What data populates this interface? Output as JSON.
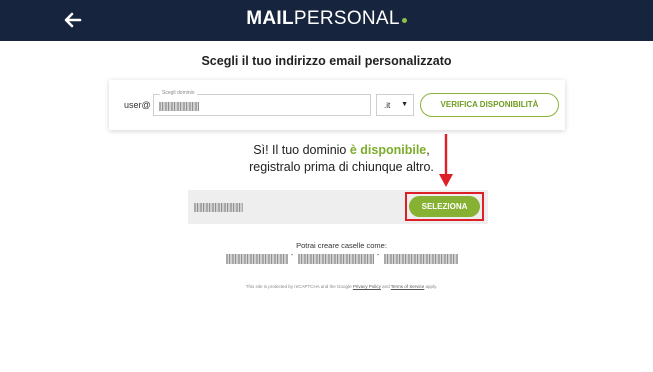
{
  "header": {
    "logo_bold": "MAIL",
    "logo_light": "PERSONAL",
    "colors": {
      "background": "#16253d",
      "accent": "#8bc34a"
    }
  },
  "main": {
    "title": "Scegli il tuo indirizzo email personalizzato",
    "search": {
      "prefix": "user@",
      "field_label": "Scegli dominio",
      "tld_selected": ".it",
      "verify_label": "VERIFICA DISPONIBILITÀ"
    },
    "result": {
      "line1_pre": "Sì! Il tuo dominio ",
      "line1_highlight": "è disponibile",
      "line1_post": ",",
      "line2": "registralo prima di chiunque altro."
    },
    "select_label": "SELEZIONA",
    "could_create_label": "Potrai creare caselle come:",
    "separators": [
      "-",
      "-"
    ],
    "recaptcha": {
      "pre": "This site is protected by reCAPTCHA and the Google ",
      "privacy": "Privacy Policy",
      "mid": " and ",
      "terms": "Terms of Service",
      "post": " apply."
    }
  },
  "annotation_colors": {
    "highlight": "#dd1f26",
    "button": "#86b133"
  }
}
